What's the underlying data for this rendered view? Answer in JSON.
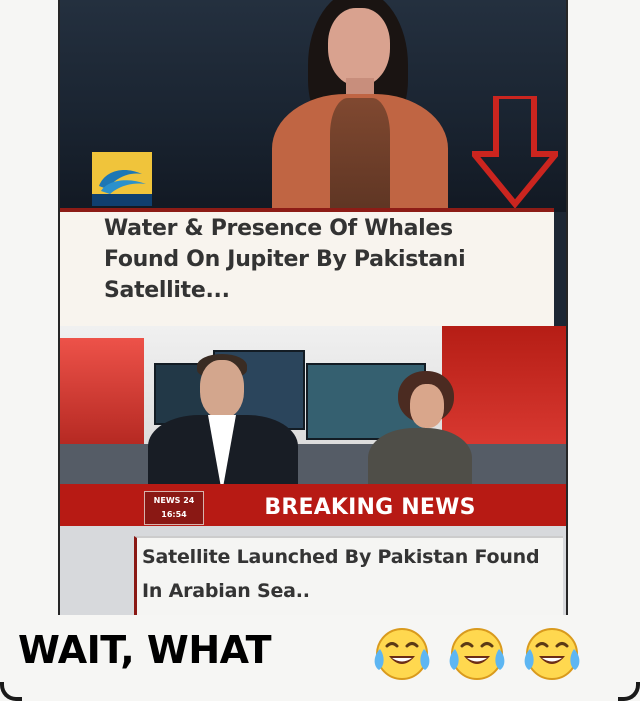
{
  "top_panel": {
    "headline": "Water & Presence Of Whales Found On Jupiter By Pakistani Satellite..."
  },
  "bottom_panel": {
    "channel_badge_line1": "NEWS 24",
    "channel_badge_line2": "16:54",
    "breaking_label": "BREAKING NEWS",
    "headline": "Satellite Launched By Pakistan Found In Arabian Sea.."
  },
  "reaction": {
    "text": "WAIT, WHAT"
  },
  "colors": {
    "breaking_red": "#b71a14",
    "caption_red_border": "#8d1c16",
    "emoji_yellow": "#ffd84f",
    "tear_blue": "#5db6f2"
  }
}
